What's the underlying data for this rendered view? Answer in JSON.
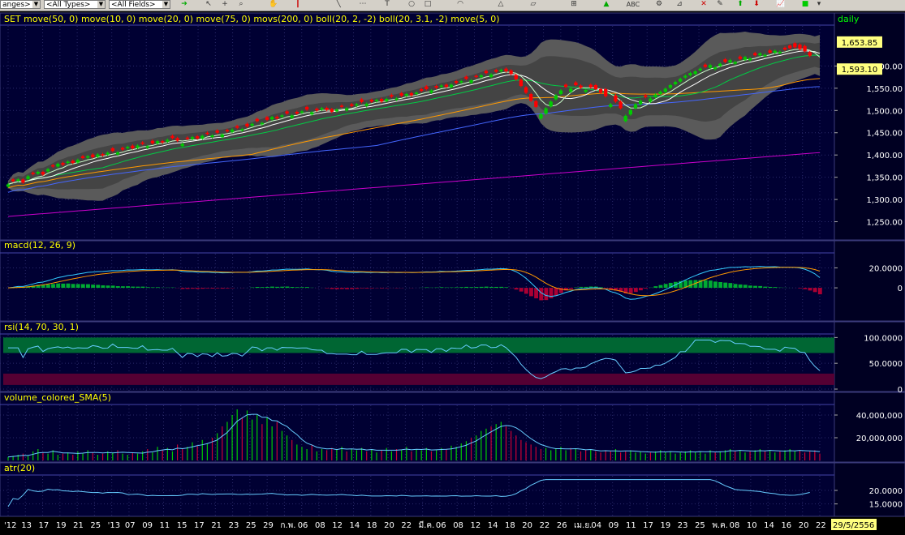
{
  "toolbar": {
    "ranges_label": "anges>",
    "types_label": "<All Types>",
    "fields_label": "<All Fields>",
    "tools_label": "ABC"
  },
  "chart_data": [
    {
      "type": "candlestick",
      "title": "SET move(50, 0) move(10, 0) move(20, 0) move(75, 0) movs(200, 0) boll(20, 2, -2) boll(20, 3.1, -2) move(5, 0)",
      "period_label": "daily",
      "ylim": [
        1220,
        1690
      ],
      "y_ticks": [
        1250,
        1300,
        1350,
        1400,
        1450,
        1500,
        1550,
        1600
      ],
      "y_tick_labels": [
        "1,250.00",
        "1,300.00",
        "1,350.00",
        "1,400.00",
        "1,450.00",
        "1,500.00",
        "1,550.00",
        "1,600.00"
      ],
      "price_labels": [
        {
          "value": 1653.85,
          "text": "1,653.85"
        },
        {
          "value": 1593.1,
          "text": "1,593.10"
        }
      ],
      "close": [
        1334,
        1341,
        1345,
        1338,
        1352,
        1357,
        1362,
        1356,
        1368,
        1374,
        1380,
        1378,
        1385,
        1382,
        1389,
        1393,
        1397,
        1395,
        1401,
        1399,
        1405,
        1409,
        1406,
        1412,
        1418,
        1415,
        1421,
        1425,
        1420,
        1426,
        1431,
        1428,
        1434,
        1438,
        1432,
        1425,
        1436,
        1440,
        1437,
        1443,
        1447,
        1444,
        1450,
        1446,
        1453,
        1457,
        1461,
        1458,
        1464,
        1470,
        1476,
        1472,
        1479,
        1485,
        1482,
        1489,
        1493,
        1489,
        1493,
        1498,
        1502,
        1496,
        1500,
        1505,
        1501,
        1497,
        1502,
        1508,
        1505,
        1510,
        1514,
        1519,
        1515,
        1520,
        1524,
        1520,
        1526,
        1531,
        1527,
        1533,
        1537,
        1534,
        1540,
        1544,
        1548,
        1545,
        1551,
        1556,
        1553,
        1558,
        1562,
        1566,
        1571,
        1568,
        1575,
        1579,
        1584,
        1581,
        1587,
        1591,
        1588,
        1582,
        1570,
        1555,
        1540,
        1522,
        1508,
        1492,
        1505,
        1520,
        1534,
        1545,
        1553,
        1549,
        1557,
        1551,
        1546,
        1552,
        1548,
        1540,
        1532,
        1514,
        1520,
        1505,
        1488,
        1501,
        1514,
        1522,
        1530,
        1527,
        1536,
        1542,
        1549,
        1557,
        1564,
        1571,
        1578,
        1584,
        1588,
        1594,
        1598,
        1602,
        1597,
        1605,
        1609,
        1613,
        1609,
        1616,
        1620,
        1617,
        1624,
        1628,
        1625,
        1630,
        1634,
        1632,
        1637,
        1640,
        1642,
        1638,
        1633,
        1623,
        1612,
        1593
      ],
      "open_offset": [
        -5,
        4,
        -3,
        7,
        -6,
        3,
        -4,
        6,
        -5,
        3,
        -6,
        4,
        -3,
        5,
        -6,
        4,
        -3,
        6,
        -5,
        3,
        -4,
        6,
        -5,
        4,
        -3,
        6,
        -5,
        3,
        -4,
        6,
        -5,
        3,
        -4,
        5,
        6,
        -5,
        3,
        -4,
        5,
        -6,
        3,
        -4,
        5,
        -6,
        3,
        -5,
        4,
        -3,
        6,
        -4,
        5,
        -3,
        6,
        -5,
        4,
        -3,
        5,
        -6,
        4,
        -3,
        6,
        -5,
        4,
        -3,
        5,
        6,
        -4,
        3,
        -5,
        4,
        -3,
        6,
        -5,
        4,
        -3,
        6,
        -5,
        4,
        -3,
        6,
        -4,
        5,
        -3,
        4,
        6,
        -5,
        4,
        -3,
        5,
        -6,
        4,
        -3,
        5,
        -6,
        3,
        -4,
        5,
        -6,
        4,
        -3,
        6,
        8,
        10,
        14,
        12,
        15,
        13,
        -10,
        -12,
        -11,
        -9,
        -8,
        5,
        -7,
        6,
        5,
        -4,
        6,
        9,
        8,
        16,
        -6,
        14,
        15,
        -12,
        -10,
        -9,
        -8,
        4,
        -7,
        -6,
        -5,
        -7,
        -6,
        -5,
        -6,
        -4,
        -5,
        -6,
        -4,
        5,
        -6,
        -4,
        -5,
        6,
        -5,
        -4,
        5,
        -6,
        -4,
        5,
        -4,
        -3,
        5,
        -4,
        -3,
        4,
        6,
        9,
        10,
        12,
        8
      ]
    },
    {
      "type": "line",
      "title": "macd(12, 26, 9)",
      "ylim": [
        -30,
        35
      ],
      "y_ticks": [
        0,
        20
      ],
      "y_tick_labels": [
        "0",
        "20.0000"
      ]
    },
    {
      "type": "line",
      "title": "rsi(14, 70, 30, 1)",
      "ylim": [
        0,
        110
      ],
      "y_ticks": [
        0,
        50,
        100
      ],
      "y_tick_labels": [
        "0",
        "50.0000",
        "100.0000"
      ],
      "bands": [
        70,
        30
      ]
    },
    {
      "type": "bar",
      "title": "volume_colored_SMA(5)",
      "ylim": [
        0,
        50000000
      ],
      "y_ticks": [
        20000000,
        40000000
      ],
      "y_tick_labels": [
        "20,000,000",
        "40,000,000"
      ],
      "values_m": [
        3,
        4,
        5,
        6,
        4,
        8,
        10,
        7,
        6,
        9,
        5,
        6,
        7,
        5,
        8,
        6,
        9,
        7,
        5,
        6,
        8,
        7,
        9,
        6,
        5,
        7,
        6,
        8,
        10,
        7,
        12,
        9,
        11,
        8,
        14,
        10,
        12,
        16,
        13,
        18,
        15,
        20,
        24,
        30,
        34,
        40,
        45,
        38,
        44,
        36,
        40,
        32,
        38,
        30,
        34,
        26,
        22,
        18,
        14,
        12,
        10,
        14,
        8,
        10,
        9,
        11,
        10,
        12,
        8,
        10,
        9,
        11,
        8,
        10,
        7,
        9,
        11,
        8,
        10,
        9,
        12,
        8,
        10,
        9,
        11,
        8,
        9,
        11,
        10,
        13,
        12,
        15,
        17,
        20,
        22,
        26,
        28,
        30,
        32,
        34,
        30,
        26,
        22,
        18,
        16,
        14,
        12,
        10,
        11,
        9,
        10,
        12,
        9,
        11,
        10,
        8,
        9,
        10,
        8,
        7,
        9,
        8,
        10,
        7,
        8,
        9,
        7,
        8,
        6,
        7,
        8,
        9,
        7,
        8,
        6,
        7,
        8,
        9,
        7,
        8,
        6,
        9,
        7,
        8,
        9,
        10,
        8,
        9,
        7,
        8,
        9,
        10,
        8,
        9,
        7,
        8,
        9,
        10,
        8,
        9,
        7,
        8,
        9,
        6
      ]
    },
    {
      "type": "line",
      "title": "atr(20)",
      "ylim": [
        11,
        26
      ],
      "y_ticks": [
        15,
        20
      ],
      "y_tick_labels": [
        "15.0000",
        "20.0000"
      ]
    }
  ],
  "x_axis": {
    "labels": [
      "'12",
      "13",
      "17",
      "19",
      "21",
      "25",
      "'13",
      "07",
      "09",
      "11",
      "15",
      "17",
      "21",
      "23",
      "25",
      "29",
      "ก.พ.",
      "06",
      "08",
      "12",
      "14",
      "18",
      "20",
      "22",
      "มี.ค.",
      "06",
      "08",
      "12",
      "14",
      "18",
      "20",
      "22",
      "26",
      "เม.ย.",
      "04",
      "09",
      "11",
      "17",
      "19",
      "23",
      "25",
      "พ.ค.",
      "08",
      "10",
      "14",
      "16",
      "20",
      "22"
    ],
    "current_date": "29/5/2556"
  }
}
